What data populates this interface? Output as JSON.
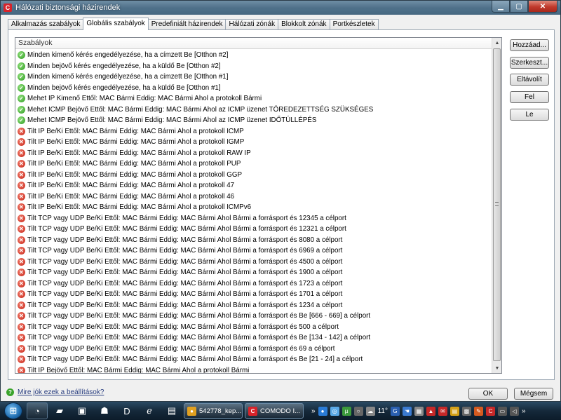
{
  "window": {
    "title": "Hálózati biztonsági házirendek",
    "title_icon": "C",
    "minimize_glyph": "▁",
    "maximize_glyph": "▢",
    "close_glyph": "✕"
  },
  "tabs": [
    {
      "label": "Alkalmazás szabályok",
      "active": false
    },
    {
      "label": "Globális szabályok",
      "active": true
    },
    {
      "label": "Predefiniált házirendek",
      "active": false
    },
    {
      "label": "Hálózati zónák",
      "active": false
    },
    {
      "label": "Blokkolt zónák",
      "active": false
    },
    {
      "label": "Portkészletek",
      "active": false
    }
  ],
  "list": {
    "header": "Szabályok",
    "rows": [
      {
        "type": "allow",
        "text": "Minden kimenő kérés engedélyezése, ha a címzett Be [Otthon #2]"
      },
      {
        "type": "allow",
        "text": "Minden bejövő kérés engedélyezése, ha a küldő Be [Otthon #2]"
      },
      {
        "type": "allow",
        "text": "Minden kimenő kérés engedélyezése, ha a címzett Be [Otthon #1]"
      },
      {
        "type": "allow",
        "text": "Minden bejövő kérés engedélyezése, ha a küldő Be [Otthon #1]"
      },
      {
        "type": "allow",
        "text": "Mehet IP Kimenő Ettől: MAC Bármi Eddig: MAC Bármi Ahol a protokoll Bármi"
      },
      {
        "type": "allow",
        "text": "Mehet ICMP Bejövő Ettől: MAC Bármi Eddig: MAC Bármi Ahol az ICMP üzenet TÖREDEZETTSÉG SZÜKSÉGES"
      },
      {
        "type": "allow",
        "text": "Mehet ICMP Bejövő Ettől: MAC Bármi Eddig: MAC Bármi Ahol az ICMP üzenet IDŐTÚLLÉPÉS"
      },
      {
        "type": "block",
        "text": "Tilt IP Be/Ki Ettől: MAC Bármi Eddig: MAC Bármi Ahol a protokoll ICMP"
      },
      {
        "type": "block",
        "text": "Tilt IP Be/Ki Ettől: MAC Bármi Eddig: MAC Bármi Ahol a protokoll IGMP"
      },
      {
        "type": "block",
        "text": "Tilt IP Be/Ki Ettől: MAC Bármi Eddig: MAC Bármi Ahol a protokoll RAW IP"
      },
      {
        "type": "block",
        "text": "Tilt IP Be/Ki Ettől: MAC Bármi Eddig: MAC Bármi Ahol a protokoll PUP"
      },
      {
        "type": "block",
        "text": "Tilt IP Be/Ki Ettől: MAC Bármi Eddig: MAC Bármi Ahol a protokoll GGP"
      },
      {
        "type": "block",
        "text": "Tilt IP Be/Ki Ettől: MAC Bármi Eddig: MAC Bármi Ahol a protokoll 47"
      },
      {
        "type": "block",
        "text": "Tilt IP Be/Ki Ettől: MAC Bármi Eddig: MAC Bármi Ahol a protokoll 46"
      },
      {
        "type": "block",
        "text": "Tilt IP Be/Ki Ettől: MAC Bármi Eddig: MAC Bármi Ahol a protokoll ICMPv6"
      },
      {
        "type": "block",
        "text": "Tilt TCP vagy UDP Be/Ki Ettől: MAC Bármi Eddig: MAC Bármi Ahol Bármi a forrásport és 12345 a célport"
      },
      {
        "type": "block",
        "text": "Tilt TCP vagy UDP Be/Ki Ettől: MAC Bármi Eddig: MAC Bármi Ahol Bármi a forrásport és 12321 a célport"
      },
      {
        "type": "block",
        "text": "Tilt TCP vagy UDP Be/Ki Ettől: MAC Bármi Eddig: MAC Bármi Ahol Bármi a forrásport és 8080 a célport"
      },
      {
        "type": "block",
        "text": "Tilt TCP vagy UDP Be/Ki Ettől: MAC Bármi Eddig: MAC Bármi Ahol Bármi a forrásport és 6969 a célport"
      },
      {
        "type": "block",
        "text": "Tilt TCP vagy UDP Be/Ki Ettől: MAC Bármi Eddig: MAC Bármi Ahol Bármi a forrásport és 4500 a célport"
      },
      {
        "type": "block",
        "text": "Tilt TCP vagy UDP Be/Ki Ettől: MAC Bármi Eddig: MAC Bármi Ahol Bármi a forrásport és 1900 a célport"
      },
      {
        "type": "block",
        "text": "Tilt TCP vagy UDP Be/Ki Ettől: MAC Bármi Eddig: MAC Bármi Ahol Bármi a forrásport és 1723 a célport"
      },
      {
        "type": "block",
        "text": "Tilt TCP vagy UDP Be/Ki Ettől: MAC Bármi Eddig: MAC Bármi Ahol Bármi a forrásport és 1701 a célport"
      },
      {
        "type": "block",
        "text": "Tilt TCP vagy UDP Be/Ki Ettől: MAC Bármi Eddig: MAC Bármi Ahol Bármi a forrásport és 1234 a célport"
      },
      {
        "type": "block",
        "text": "Tilt TCP vagy UDP Be/Ki Ettől: MAC Bármi Eddig: MAC Bármi Ahol Bármi a forrásport és Be [666 - 669] a célport"
      },
      {
        "type": "block",
        "text": "Tilt TCP vagy UDP Be/Ki Ettől: MAC Bármi Eddig: MAC Bármi Ahol Bármi a forrásport és 500 a célport"
      },
      {
        "type": "block",
        "text": "Tilt TCP vagy UDP Be/Ki Ettől: MAC Bármi Eddig: MAC Bármi Ahol Bármi a forrásport és Be [134 - 142] a célport"
      },
      {
        "type": "block",
        "text": "Tilt TCP vagy UDP Be/Ki Ettől: MAC Bármi Eddig: MAC Bármi Ahol Bármi a forrásport és 69 a célport"
      },
      {
        "type": "block",
        "text": "Tilt TCP vagy UDP Be/Ki Ettől: MAC Bármi Eddig: MAC Bármi Ahol Bármi a forrásport és Be [21 - 24] a célport"
      },
      {
        "type": "block",
        "text": "Tilt IP Bejövő Ettől: MAC Bármi Eddig: MAC Bármi Ahol a protokoll Bármi"
      }
    ]
  },
  "side_buttons": {
    "add": "Hozzáad...",
    "edit": "Szerkeszt...",
    "remove": "Eltávolít",
    "up": "Fel",
    "down": "Le"
  },
  "footer": {
    "help_icon": "?",
    "help_link": "Mire jók ezek a beállítások?",
    "ok": "OK",
    "cancel": "Mégsem"
  },
  "taskbar": {
    "start_glyph": "⊞",
    "tasks": [
      {
        "label": "542778_kep...",
        "icon": "chrome-icon",
        "color": "#e0a020"
      },
      {
        "label": "COMODO I...",
        "icon": "comodo-icon",
        "color": "#d8232a"
      }
    ],
    "tray_text_1": "»",
    "tray_text_2": "11°",
    "tray_text_3": "»"
  },
  "colors": {
    "allow": "#2e9a22",
    "block": "#c8271a",
    "title": "#50718a"
  }
}
